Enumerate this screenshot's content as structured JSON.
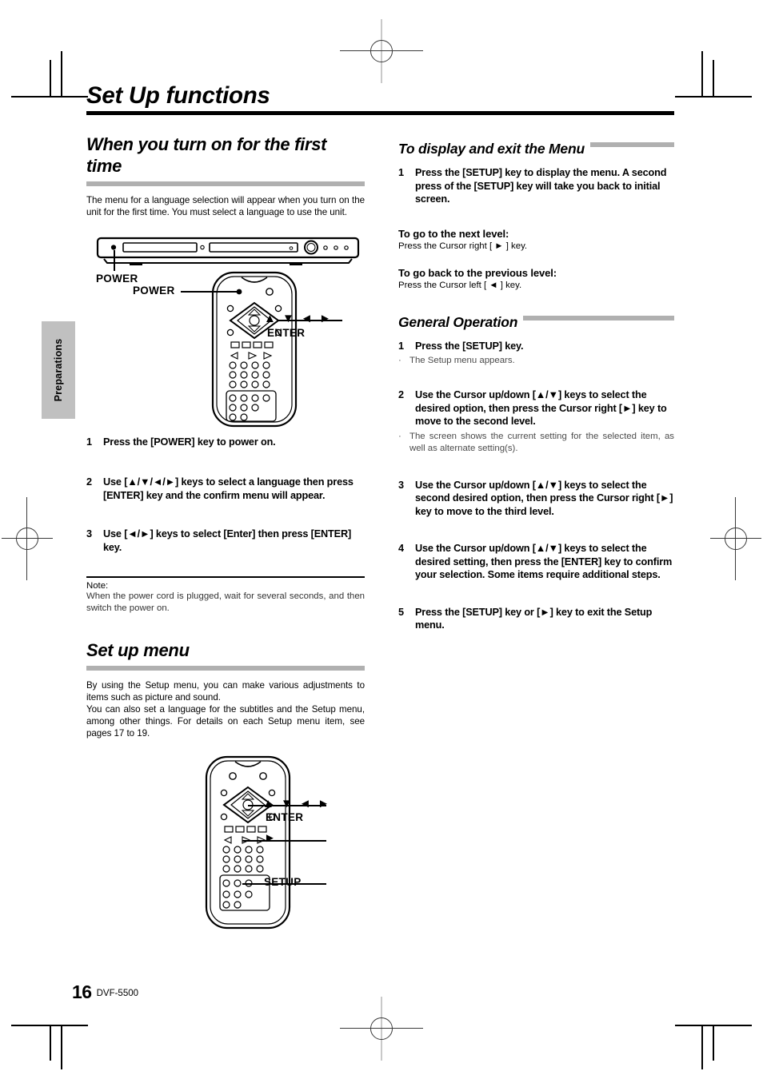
{
  "page": {
    "section_tab": "Preparations",
    "folio_number": "16",
    "model": "DVF-5500",
    "title": "Set Up functions"
  },
  "left_column": {
    "heading": "When you turn on for the first time",
    "intro": "The menu for a language selection will appear when you turn on the unit for the first time. You must select a language to use the unit.",
    "figure_top": {
      "label_player_power": "POWER",
      "label_remote_power": "POWER",
      "label_cursor_keys": "▲ ▼ ◄ ►",
      "label_enter": "ENTER"
    },
    "steps": [
      {
        "num": "1",
        "text": "Press the [POWER] key to power on."
      },
      {
        "num": "2",
        "text": "Use [▲/▼/◄/►] keys to select a language then press [ENTER] key and the confirm menu will appear."
      },
      {
        "num": "3",
        "text": "Use [◄/►] keys to select [Enter] then press [ENTER] key."
      }
    ],
    "note": {
      "title": "Note:",
      "body": "When the power cord is plugged, wait for several seconds, and then switch the power on."
    },
    "setup_menu": {
      "heading": "Set up menu",
      "paragraph1": "By using the Setup menu, you can make various adjustments to items such as picture and sound.",
      "paragraph2": "You can also set a language for the subtitles and the Setup menu, among other things. For details on each Setup menu item, see pages 17 to 19."
    },
    "figure_bottom": {
      "label_cursor_keys": "▲ ▼ ◄ ►",
      "label_enter": "ENTER",
      "label_play": "►",
      "label_setup": "SETUP"
    }
  },
  "right_column": {
    "section1": {
      "heading": "To display and exit the Menu",
      "steps": [
        {
          "num": "1",
          "text": "Press the [SETUP] key to display the menu. A second press of the [SETUP] key will take you back to initial screen."
        }
      ],
      "sub1": {
        "heading": "To go to the next level:",
        "body": "Press the Cursor right [ ► ] key."
      },
      "sub2": {
        "heading": "To go back to the previous level:",
        "body": "Press the Cursor left [ ◄ ] key."
      }
    },
    "section2": {
      "heading": "General Operation",
      "steps": [
        {
          "num": "1",
          "text": "Press the [SETUP] key.",
          "bullets": [
            "The Setup menu appears."
          ]
        },
        {
          "num": "2",
          "text": "Use the Cursor up/down [▲/▼] keys to select the desired option, then press the Cursor right [►] key to move to the second level.",
          "bullets": [
            "The screen shows the current setting for the selected item, as well as alternate setting(s)."
          ]
        },
        {
          "num": "3",
          "text": "Use the Cursor up/down [▲/▼] keys to select the second desired option, then press the Cursor right [►] key to move to the third level.",
          "bullets": []
        },
        {
          "num": "4",
          "text": "Use the Cursor up/down [▲/▼] keys to select the desired setting, then press the [ENTER] key to confirm your selection. Some items require additional steps.",
          "bullets": []
        },
        {
          "num": "5",
          "text": "Press the [SETUP] key or [►] key to exit the Setup menu.",
          "bullets": []
        }
      ]
    }
  },
  "colors": {
    "rule_black": "#000000",
    "rule_gray": "#b0b0b0",
    "tab_gray": "#c0c0c0"
  }
}
